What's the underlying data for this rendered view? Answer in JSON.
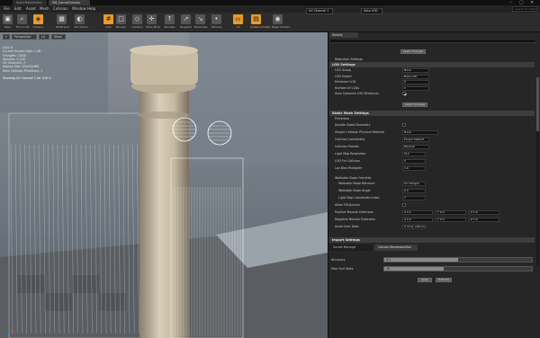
{
  "window": {
    "tabs": [
      "StaticMeshEditor",
      "SM_CornerColumn"
    ],
    "controls": [
      "–",
      "▢",
      "✕"
    ]
  },
  "menubar": {
    "items": [
      "File",
      "Edit",
      "Asset",
      "Mesh",
      "Collision",
      "Window",
      "Help"
    ],
    "search_placeholder": "Search For Help"
  },
  "toolbar": {
    "buttons": [
      {
        "label": "Save",
        "icon": "save-icon"
      },
      {
        "label": "Find in CB",
        "icon": "find-icon"
      },
      {
        "label": "Collision",
        "icon": "collision-icon"
      },
      {
        "label": "Wireframe",
        "icon": "wireframe-icon"
      },
      {
        "label": "Vert Colors",
        "icon": "vertex-colors-icon"
      },
      {
        "label": "Grid",
        "icon": "grid-icon"
      },
      {
        "label": "Bounds",
        "icon": "bounds-icon"
      },
      {
        "label": "Collision",
        "icon": "collision2-icon"
      },
      {
        "label": "Show Pivot",
        "icon": "pivot-icon"
      },
      {
        "label": "Normals",
        "icon": "normals-icon"
      },
      {
        "label": "Tangents",
        "icon": "tangents-icon"
      },
      {
        "label": "Binormals",
        "icon": "binormals-icon"
      },
      {
        "label": "Vertices",
        "icon": "vertices-icon"
      },
      {
        "label": "UV",
        "icon": "uv-icon"
      },
      {
        "label": "Additional Data",
        "icon": "data-icon"
      },
      {
        "label": "Reset Camera",
        "icon": "camera-icon"
      }
    ],
    "uv_channel": "UV Channel 1",
    "lod": "Auto LOD"
  },
  "viewport": {
    "perspective_label": "Perspective",
    "lit_label": "Lit",
    "show_label": "Show",
    "info": [
      "LOD: 0",
      "Current Screen Size: 1.48",
      "Triangles: 3,635",
      "Vertices: 3,148",
      "UV Channels: 2",
      "Approx Size: 53x53x569",
      "Num Collision Primitives: 1"
    ],
    "status": "Showing UV channel 1 for LOD 0"
  },
  "details": {
    "tab": "Details",
    "apply_changes": "Apply Changes",
    "reduction_settings": "Reduction Settings",
    "lod_settings_header": "LOD Settings",
    "lod_rows": [
      {
        "label": "LOD Group",
        "value": "None"
      },
      {
        "label": "LOD Import",
        "value": "Base LOD"
      },
      {
        "label": "Minimum LOD",
        "value": "0"
      },
      {
        "label": "Number of LODs",
        "value": "1"
      },
      {
        "label": "Auto Compute LOD Distances",
        "value": ""
      }
    ],
    "static_mesh_header": "Static Mesh Settings",
    "primitives_header": "Primitives",
    "sm_rows": [
      {
        "label": "Double Sided Geometry",
        "value": ""
      },
      {
        "label": "Simple Collision Physical Material",
        "value": "None"
      },
      {
        "label": "Collision Complexity",
        "value": "Project Default"
      },
      {
        "label": "Collision Presets",
        "value": "BlockAll"
      },
      {
        "label": "Light Map Resolution",
        "value": "512"
      },
      {
        "label": "LOD For Collision",
        "value": "0"
      },
      {
        "label": "Lpv Bias Multiplier",
        "value": "1.0"
      }
    ],
    "nav_header": "Walkable Slope Override",
    "nav_rows": [
      {
        "label": "Walkable Slope Behavior",
        "value": "Unchanged"
      },
      {
        "label": "Walkable Slope Angle",
        "value": "0.0"
      },
      {
        "label": "Light Map Coordinate Index",
        "value": "1"
      },
      {
        "label": "Allow CPUAccess",
        "value": ""
      },
      {
        "label": "Positive Bounds Extension",
        "value": ""
      },
      {
        "label": "Negative Bounds Extension",
        "value": ""
      },
      {
        "label": "Asset User Data",
        "value": "0 Array elements"
      }
    ],
    "bounds_values": {
      "x": "X 0.0",
      "y": "Y 0.0",
      "z": "Z 0.0"
    },
    "import_header": "Import Settings"
  },
  "bottom_panel": {
    "tabs": [
      "Socket Manager",
      "Convex Decomposition"
    ],
    "accuracy_label": "Accuracy",
    "accuracy_value": "0.5",
    "accuracy_fraction": 0.5,
    "hull_label": "Max Hull Verts",
    "hull_value": "16",
    "hull_fraction": 0.4,
    "apply_label": "Apply",
    "defaults_label": "Defaults"
  }
}
